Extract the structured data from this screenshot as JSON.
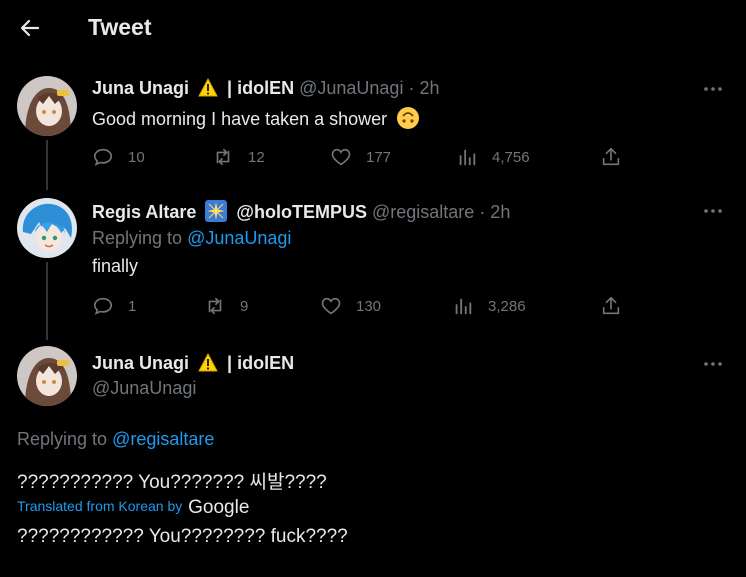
{
  "header": {
    "title": "Tweet"
  },
  "tweets": [
    {
      "name": "Juna Unagi",
      "name_suffix": "| idolEN",
      "handle": "@JunaUnagi",
      "time": "· 2h",
      "text": "Good morning I have taken a shower",
      "replies": "10",
      "retweets": "12",
      "likes": "177",
      "views": "4,756"
    },
    {
      "name": "Regis Altare",
      "name_suffix": "@holoTEMPUS",
      "handle": "@regisaltare",
      "time": "· 2h",
      "replying_label": "Replying to",
      "replying_handle": "@JunaUnagi",
      "text": "finally",
      "replies": "1",
      "retweets": "9",
      "likes": "130",
      "views": "3,286"
    }
  ],
  "main": {
    "name": "Juna Unagi",
    "name_suffix": "| idolEN",
    "handle": "@JunaUnagi",
    "replying_label": "Replying to",
    "replying_handle": "@regisaltare",
    "original_text": "??????????? You??????? 씨발????",
    "translated_label": "Translated from Korean by",
    "translated_brand": "Google",
    "translated_text": "???????????? You???????? fuck????"
  },
  "colors": {
    "background": "#000000",
    "text": "#e7e9ea",
    "muted": "#71767b",
    "link": "#1d9bf0",
    "warning": "#ffd400"
  },
  "icons": [
    "back-arrow-icon",
    "warning-icon",
    "upside-down-face-emoji",
    "sparkle-badge-icon",
    "more-icon",
    "reply-icon",
    "retweet-icon",
    "like-icon",
    "views-icon",
    "share-icon"
  ]
}
